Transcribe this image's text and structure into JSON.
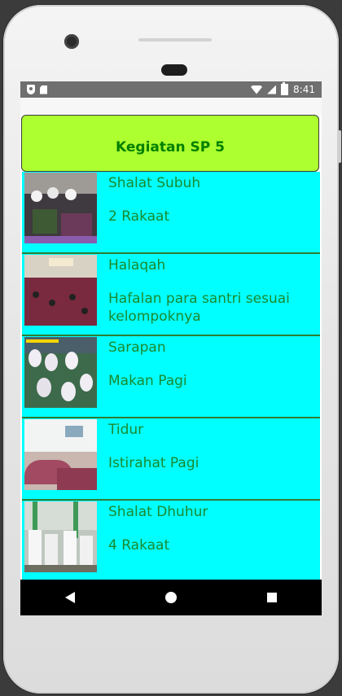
{
  "status_bar": {
    "time": "8:41",
    "icons": [
      "shield-icon",
      "sd-card-icon",
      "wifi-icon",
      "signal-icon",
      "battery-icon"
    ]
  },
  "header": {
    "title": "Kegiatan SP 5",
    "background": "#adff2f",
    "text_color": "#008000"
  },
  "list": {
    "background": "#00ffff",
    "items": [
      {
        "title": "Shalat Subuh",
        "subtitle": "2 Rakaat"
      },
      {
        "title": "Halaqah",
        "subtitle": "Hafalan para santri sesuai kelompoknya"
      },
      {
        "title": "Sarapan",
        "subtitle": "Makan Pagi"
      },
      {
        "title": "Tidur",
        "subtitle": "Istirahat Pagi"
      },
      {
        "title": "Shalat Dhuhur",
        "subtitle": "4 Rakaat"
      }
    ]
  },
  "navigation": {
    "icons": [
      "back-icon",
      "home-icon",
      "recent-apps-icon"
    ]
  }
}
